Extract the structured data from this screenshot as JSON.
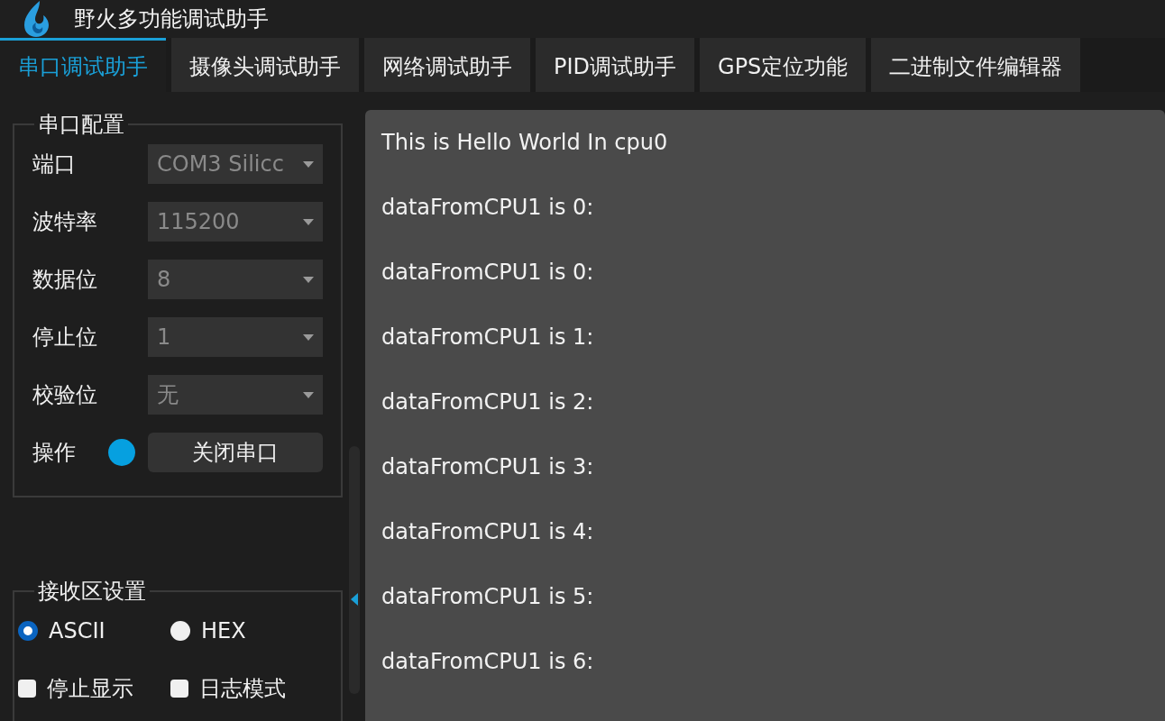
{
  "window": {
    "title": "野火多功能调试助手"
  },
  "tabs": [
    {
      "label": "串口调试助手",
      "selected": true
    },
    {
      "label": "摄像头调试助手",
      "selected": false
    },
    {
      "label": "网络调试助手",
      "selected": false
    },
    {
      "label": "PID调试助手",
      "selected": false
    },
    {
      "label": "GPS定位功能",
      "selected": false
    },
    {
      "label": "二进制文件编辑器",
      "selected": false
    }
  ],
  "serial_config": {
    "title": "串口配置",
    "fields": [
      {
        "label": "端口",
        "value": "COM3 Silicc",
        "disabled": true
      },
      {
        "label": "波特率",
        "value": "115200",
        "disabled": true
      },
      {
        "label": "数据位",
        "value": "8",
        "disabled": true
      },
      {
        "label": "停止位",
        "value": "1",
        "disabled": true
      },
      {
        "label": "校验位",
        "value": "无",
        "disabled": true
      }
    ],
    "operation": {
      "label": "操作",
      "on": true,
      "color": "#06a0e0",
      "button": "关闭串口"
    }
  },
  "receive_settings": {
    "title": "接收区设置",
    "modes": [
      {
        "label": "ASCII",
        "selected": true
      },
      {
        "label": "HEX",
        "selected": false
      }
    ],
    "options": [
      {
        "label": "停止显示",
        "checked": false
      },
      {
        "label": "日志模式",
        "checked": false
      }
    ]
  },
  "output": {
    "lines": [
      "This is Hello World In cpu0",
      "dataFromCPU1 is 0:",
      "dataFromCPU1 is 0:",
      "dataFromCPU1 is 1:",
      "dataFromCPU1 is 2:",
      "dataFromCPU1 is 3:",
      "dataFromCPU1 is 4:",
      "dataFromCPU1 is 5:",
      "dataFromCPU1 is 6:"
    ]
  }
}
